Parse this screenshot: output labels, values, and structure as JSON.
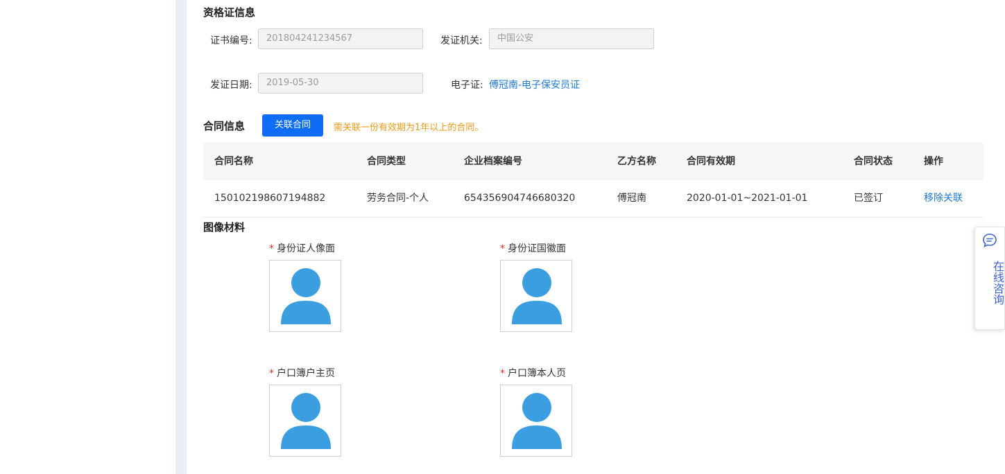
{
  "qualification": {
    "title": "资格证信息",
    "cert_no_label": "证书编号:",
    "cert_no_value": "201804241234567",
    "issuer_label": "发证机关:",
    "issuer_value": "中国公安",
    "issue_date_label": "发证日期:",
    "issue_date_value": "2019-05-30",
    "ecert_label": "电子证:",
    "ecert_link": "傅冠南-电子保安员证"
  },
  "contract": {
    "title": "合同信息",
    "link_button": "关联合同",
    "notice": "需关联一份有效期为1年以上的合同。",
    "headers": [
      "合同名称",
      "合同类型",
      "企业档案编号",
      "乙方名称",
      "合同有效期",
      "合同状态",
      "操作"
    ],
    "rows": [
      {
        "name": "150102198607194882",
        "type": "劳务合同-个人",
        "archive_no": "654356904746680320",
        "party_b": "傅冠南",
        "period": "2020-01-01~2021-01-01",
        "status": "已签订",
        "action": "移除关联"
      }
    ]
  },
  "images": {
    "title": "图像材料",
    "required_mark": "*",
    "items": [
      {
        "label": "身份证人像面",
        "icon": "user-avatar-icon"
      },
      {
        "label": "身份证国徽面",
        "icon": "user-avatar-icon"
      },
      {
        "label": "户口簿户主页",
        "icon": "user-avatar-icon"
      },
      {
        "label": "户口簿本人页",
        "icon": "user-avatar-icon"
      }
    ]
  },
  "consult": {
    "icon": "chat-bubble-icon",
    "text": "在线咨询"
  },
  "colors": {
    "primary": "#0f6cf5",
    "link": "#1e7ad6",
    "notice": "#f29a17",
    "avatar": "#3a9ee0",
    "required": "#e0302b",
    "consult_text": "#3a64d8"
  }
}
